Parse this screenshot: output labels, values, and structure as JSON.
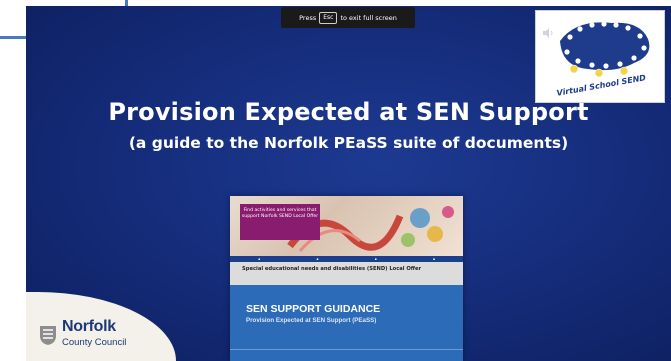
{
  "fullscreen_toast": {
    "prefix": "Press",
    "key": "Esc",
    "suffix": "to exit full screen"
  },
  "slide": {
    "title": "Provision Expected at SEN Support",
    "subtitle": "(a guide to the Norfolk PEaSS suite of documents)"
  },
  "logo": {
    "text": "Virtual School SEND",
    "icon": "virtual-school-send-logo"
  },
  "document": {
    "banner_card_text": "Find activities and services that support Norfolk SEND Local Offer",
    "strip_text": "Special educational needs and disabilities (SEND) Local Offer",
    "guide_title": "SEN SUPPORT  GUIDANCE",
    "guide_subtitle": "Provision Expected at SEN Support (PEaSS)"
  },
  "council": {
    "name": "Norfolk",
    "sub": "County Council"
  },
  "colors": {
    "slide_background": "#142b78",
    "doc_blue": "#2b6bb8",
    "council_text": "#1d3978"
  }
}
